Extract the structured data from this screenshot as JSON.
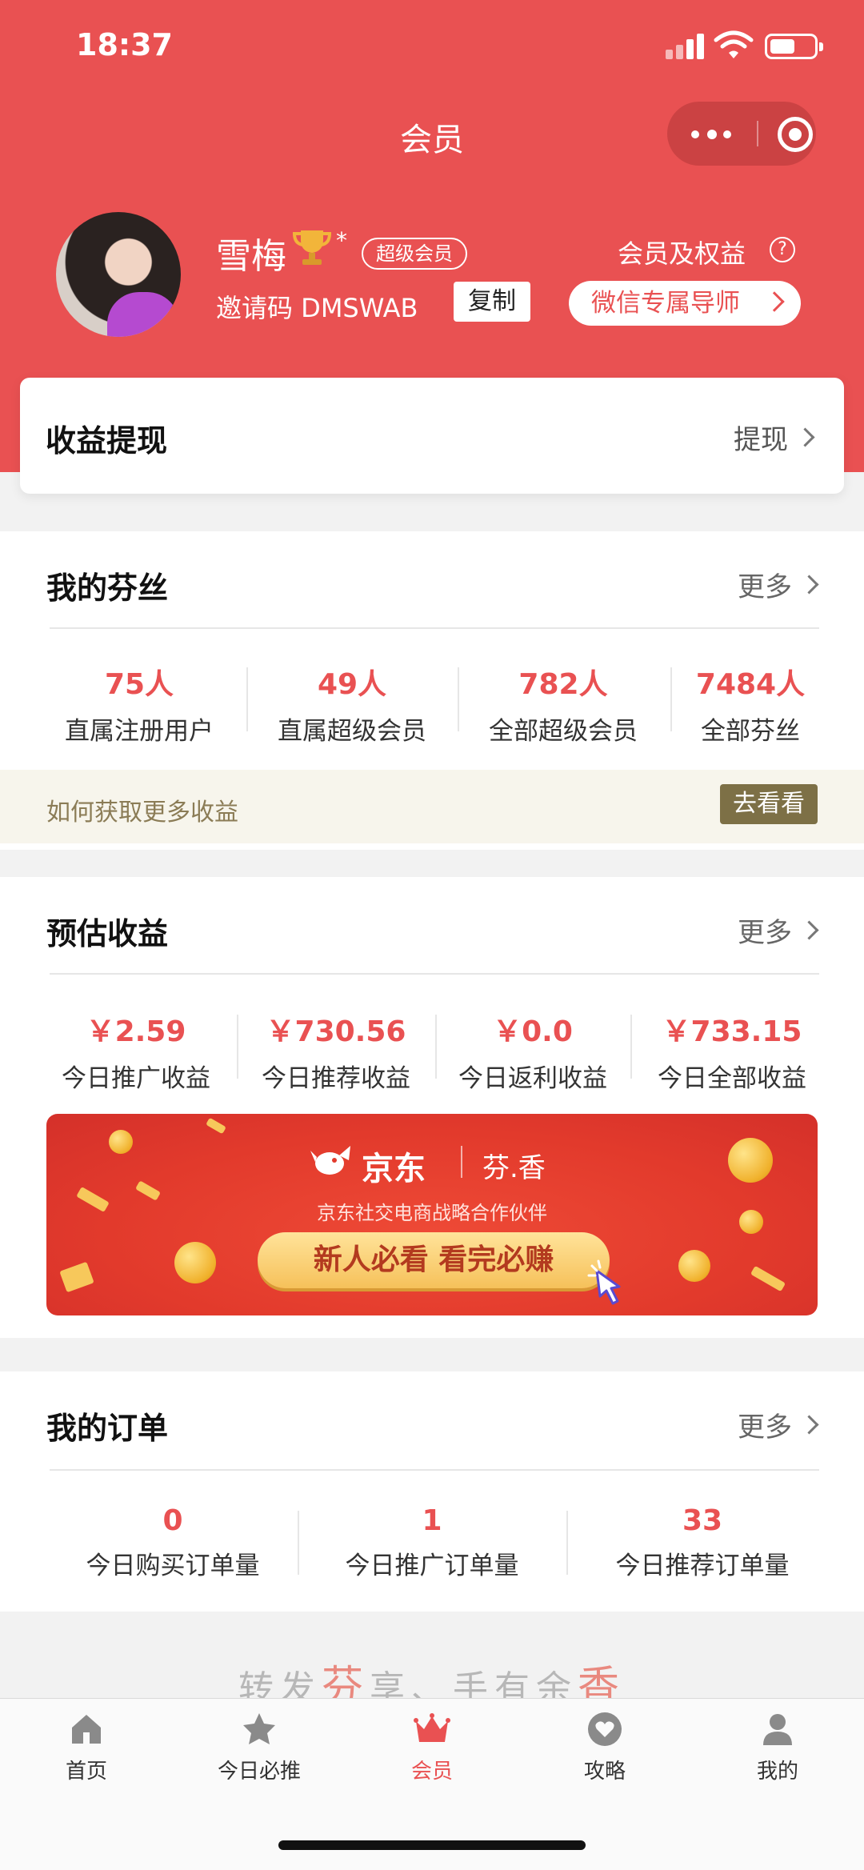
{
  "status_bar": {
    "time": "18:37"
  },
  "nav": {
    "title": "会员"
  },
  "profile": {
    "name": "雪梅",
    "star_mark": "*",
    "badge": "超级会员",
    "invite_label": "邀请码 DMSWAB",
    "copy_label": "复制",
    "rights_label": "会员及权益",
    "help_symbol": "?",
    "mentor_label": "微信专属导师"
  },
  "withdraw": {
    "title": "收益提现",
    "link": "提现"
  },
  "fans": {
    "title": "我的芬丝",
    "more": "更多",
    "stats": [
      {
        "value": "75人",
        "label": "直属注册用户"
      },
      {
        "value": "49人",
        "label": "直属超级会员"
      },
      {
        "value": "782人",
        "label": "全部超级会员"
      },
      {
        "value": "7484人",
        "label": "全部芬丝"
      }
    ],
    "tip": "如何获取更多收益",
    "tip_button": "去看看"
  },
  "earnings": {
    "title": "预估收益",
    "more": "更多",
    "stats": [
      {
        "value": "￥2.59",
        "label": "今日推广收益"
      },
      {
        "value": "￥730.56",
        "label": "今日推荐收益"
      },
      {
        "value": "￥0.0",
        "label": "今日返利收益"
      },
      {
        "value": "￥733.15",
        "label": "今日全部收益"
      }
    ]
  },
  "banner": {
    "logo_text": "京东",
    "brand": "芬.香",
    "subtitle": "京东社交电商战略合作伙伴",
    "pill": "新人必看  看完必赚"
  },
  "orders": {
    "title": "我的订单",
    "more": "更多",
    "stats": [
      {
        "value": "0",
        "label": "今日购买订单量"
      },
      {
        "value": "1",
        "label": "今日推广订单量"
      },
      {
        "value": "33",
        "label": "今日推荐订单量"
      }
    ]
  },
  "slogan": {
    "part1": "转发",
    "hl1": "芬",
    "part2": "享、手有余",
    "hl2": "香"
  },
  "tabbar": {
    "active": "会员",
    "items": [
      {
        "label": "首页",
        "icon": "home-icon"
      },
      {
        "label": "今日必推",
        "icon": "star-icon"
      },
      {
        "label": "会员",
        "icon": "crown-icon"
      },
      {
        "label": "攻略",
        "icon": "heart-icon"
      },
      {
        "label": "我的",
        "icon": "person-icon"
      }
    ]
  },
  "colors": {
    "brand_red": "#e95152",
    "tip_bg": "#f7f5ec",
    "tip_button": "#7d7046"
  }
}
